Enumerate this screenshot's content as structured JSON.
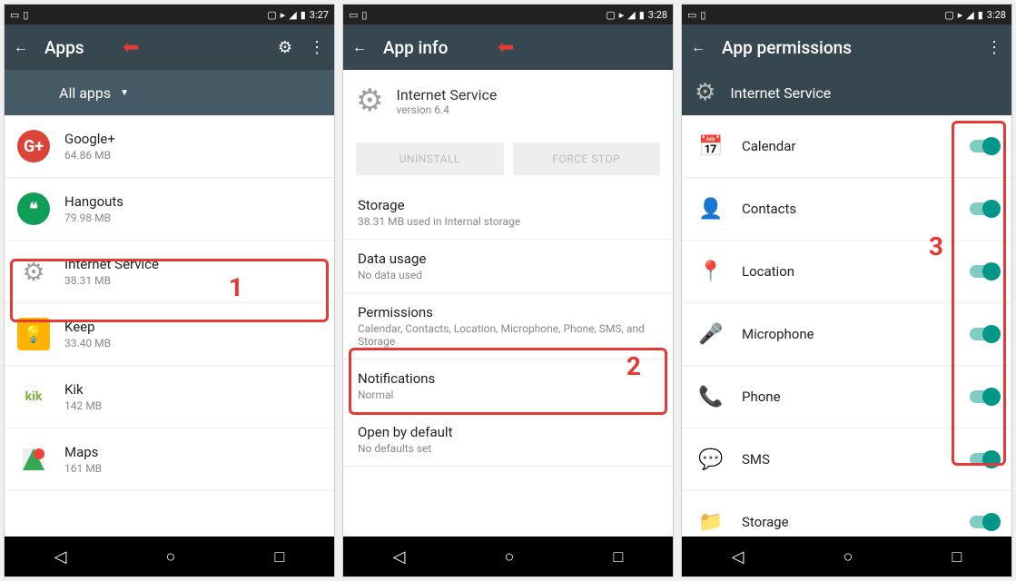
{
  "phone1": {
    "statusbar": {
      "time": "3:27"
    },
    "appbar": {
      "title": "Apps"
    },
    "subbar": {
      "label": "All apps"
    },
    "apps": [
      {
        "name": "Google+",
        "size": "64.86 MB"
      },
      {
        "name": "Hangouts",
        "size": "79.98 MB"
      },
      {
        "name": "Internet Service",
        "size": "38.31 MB"
      },
      {
        "name": "Keep",
        "size": "33.40 MB"
      },
      {
        "name": "Kik",
        "size": "142 MB"
      },
      {
        "name": "Maps",
        "size": "161 MB"
      }
    ],
    "highlight_number": "1"
  },
  "phone2": {
    "statusbar": {
      "time": "3:28"
    },
    "appbar": {
      "title": "App info"
    },
    "header": {
      "name": "Internet Service",
      "version": "version 6.4"
    },
    "btn_uninstall": "UNINSTALL",
    "btn_forcestop": "FORCE STOP",
    "sections": {
      "storage": {
        "title": "Storage",
        "sub": "38.31 MB used in Internal storage"
      },
      "data": {
        "title": "Data usage",
        "sub": "No data used"
      },
      "perm": {
        "title": "Permissions",
        "sub": "Calendar, Contacts, Location, Microphone, Phone, SMS, and Storage"
      },
      "notif": {
        "title": "Notifications",
        "sub": "Normal"
      },
      "open": {
        "title": "Open by default",
        "sub": "No defaults set"
      }
    },
    "highlight_number": "2"
  },
  "phone3": {
    "statusbar": {
      "time": "3:28"
    },
    "appbar": {
      "title": "App permissions"
    },
    "header": {
      "name": "Internet Service"
    },
    "perms": [
      {
        "label": "Calendar"
      },
      {
        "label": "Contacts"
      },
      {
        "label": "Location"
      },
      {
        "label": "Microphone"
      },
      {
        "label": "Phone"
      },
      {
        "label": "SMS"
      },
      {
        "label": "Storage"
      }
    ],
    "highlight_number": "3"
  }
}
